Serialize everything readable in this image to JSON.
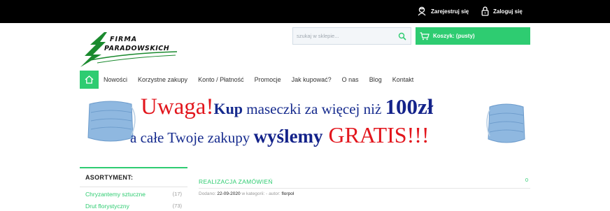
{
  "topbar": {
    "register_label": "Zarejestruj się",
    "login_label": "Zaloguj się"
  },
  "logo": {
    "line1": "FIRMA",
    "line2": "PARADOWSKICH"
  },
  "search": {
    "placeholder": "szukaj w sklepie..."
  },
  "cart": {
    "label": "Koszyk: (pusty)"
  },
  "nav": {
    "items": [
      "Nowości",
      "Korzystne zakupy",
      "Konto / Płatność",
      "Promocje",
      "Jak kupować?",
      "O nas",
      "Blog",
      "Kontakt"
    ]
  },
  "banner": {
    "l1a": "Uwaga!",
    "l1b": "Kup",
    "l1c": " maseczki za więcej niż ",
    "l1d": "100zł",
    "l2a": "a całe Twoje zakupy ",
    "l2b": "wyślemy",
    "l2c": " GRATIS!!!"
  },
  "sidebar": {
    "title": "ASORTYMENT:",
    "items": [
      {
        "label": "Chryzantemy sztuczne",
        "count": "(17)"
      },
      {
        "label": "Drut florystyczny",
        "count": "(73)"
      }
    ]
  },
  "post": {
    "title": "REALIZACJA ZAMÓWIEŃ",
    "comments": "0",
    "meta_prefix": "Dodano: ",
    "date": "22-09-2020",
    "meta_category": " w kategorii: ",
    "meta_author": " - autor: ",
    "author": "florpol"
  },
  "colors": {
    "accent": "#2ecc71",
    "topbar": "#000000",
    "banner_red": "#e2161d",
    "banner_blue": "#162b8e"
  }
}
